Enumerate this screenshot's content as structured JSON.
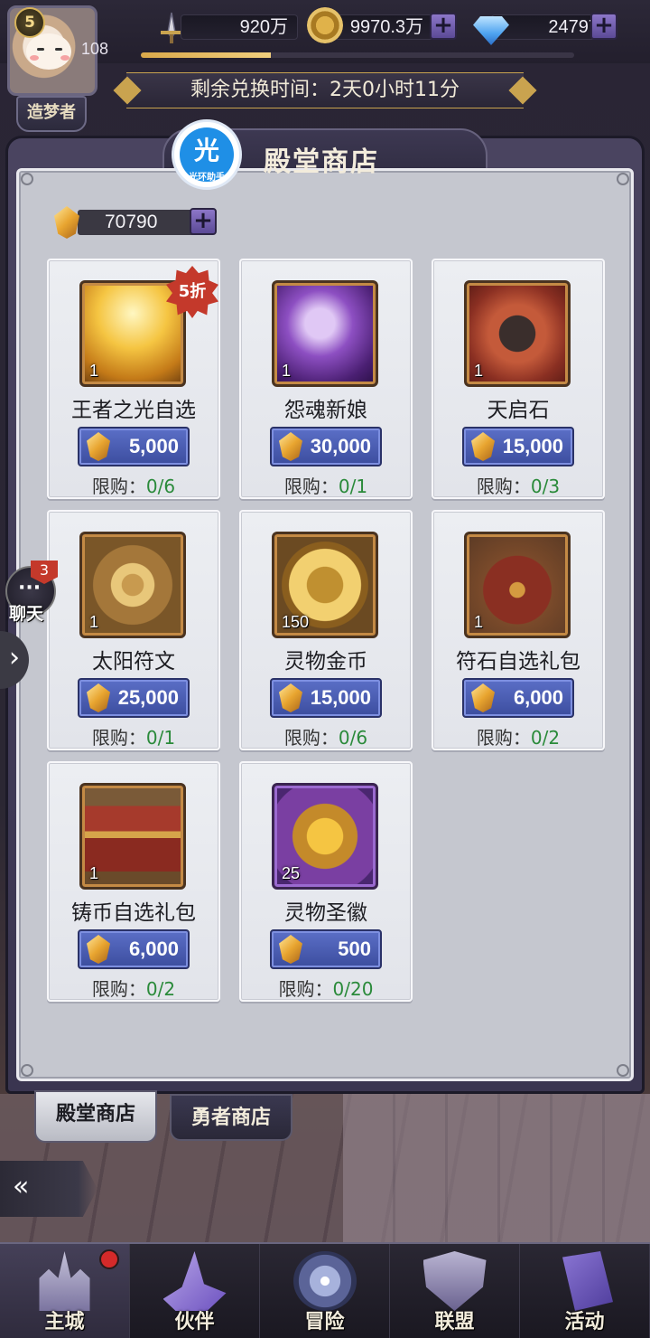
{
  "player": {
    "level": "5",
    "power_value": "108",
    "title": "造梦者"
  },
  "resources": {
    "power": "920万",
    "gold": "9970.3万",
    "diamond": "24797"
  },
  "timer": {
    "text": "剩余兑换时间：2天0小时11分"
  },
  "shop": {
    "title": "殿堂商店",
    "logo_char": "光",
    "logo_caption": "光环助手",
    "currency_amount": "70790",
    "limit_label": "限购："
  },
  "items": [
    {
      "name": "王者之光自选",
      "qty": "1",
      "price": "5,000",
      "limit": "0/6",
      "discount": "5折"
    },
    {
      "name": "怨魂新娘",
      "qty": "1",
      "price": "30,000",
      "limit": "0/1"
    },
    {
      "name": "天启石",
      "qty": "1",
      "price": "15,000",
      "limit": "0/3"
    },
    {
      "name": "太阳符文",
      "qty": "1",
      "price": "25,000",
      "limit": "0/1"
    },
    {
      "name": "灵物金币",
      "qty": "150",
      "price": "15,000",
      "limit": "0/6"
    },
    {
      "name": "符石自选礼包",
      "qty": "1",
      "price": "6,000",
      "limit": "0/2"
    },
    {
      "name": "铸币自选礼包",
      "qty": "1",
      "price": "6,000",
      "limit": "0/2"
    },
    {
      "name": "灵物圣徽",
      "qty": "25",
      "price": "500",
      "limit": "0/20"
    }
  ],
  "chat": {
    "label": "聊天",
    "badge": "3"
  },
  "tabs": [
    {
      "label": "殿堂商店",
      "active": true
    },
    {
      "label": "勇者商店",
      "active": false
    }
  ],
  "nav": [
    {
      "label": "主城",
      "icon": "castle-icon",
      "active": true
    },
    {
      "label": "伙伴",
      "icon": "wizard-hat-icon"
    },
    {
      "label": "冒险",
      "icon": "compass-icon"
    },
    {
      "label": "联盟",
      "icon": "shield-icon"
    },
    {
      "label": "活动",
      "icon": "cards-icon"
    }
  ],
  "colors": {
    "price_button": "#3c4d9e",
    "limit_value": "#2a8a3a",
    "discount_badge": "#c4392b",
    "panel_bg": "#c5c7cf"
  }
}
